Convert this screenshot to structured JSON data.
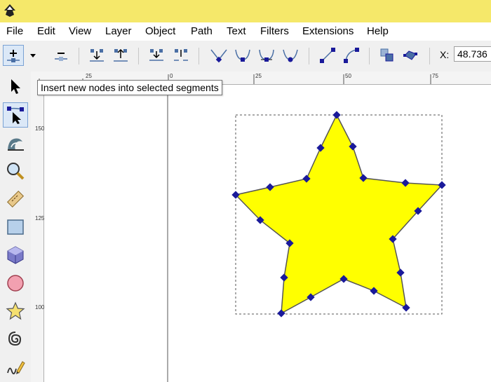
{
  "window": {
    "title": ""
  },
  "menu": {
    "items": [
      "File",
      "Edit",
      "View",
      "Layer",
      "Object",
      "Path",
      "Text",
      "Filters",
      "Extensions",
      "Help"
    ]
  },
  "toolbar": {
    "buttons": [
      "insert-node",
      "dropdown-arrow",
      "delete-node",
      "join-nodes",
      "break-path",
      "join-segment",
      "delete-segment",
      "make-cusp",
      "make-smooth",
      "make-symmetric",
      "make-auto-smooth",
      "make-line",
      "make-curve",
      "object-to-path",
      "stroke-to-path"
    ],
    "x_label": "X:",
    "x_value": "48.736"
  },
  "tooltip": {
    "text": "Insert new nodes into selected segments"
  },
  "ruler": {
    "horizontal_ticks": [
      "25",
      "0",
      "25",
      "50",
      "75"
    ],
    "vertical_ticks": [
      "150",
      "125",
      "100"
    ]
  },
  "tools": [
    "selector",
    "node-editor",
    "tweak",
    "zoom",
    "measure",
    "rectangle",
    "3d-box",
    "ellipse",
    "star-polygon",
    "spiral",
    "pencil"
  ],
  "colors": {
    "star_fill": "#ffff00",
    "star_stroke": "#555555",
    "node_color": "#1a1a9a",
    "title_bar": "#f5e86a"
  }
}
